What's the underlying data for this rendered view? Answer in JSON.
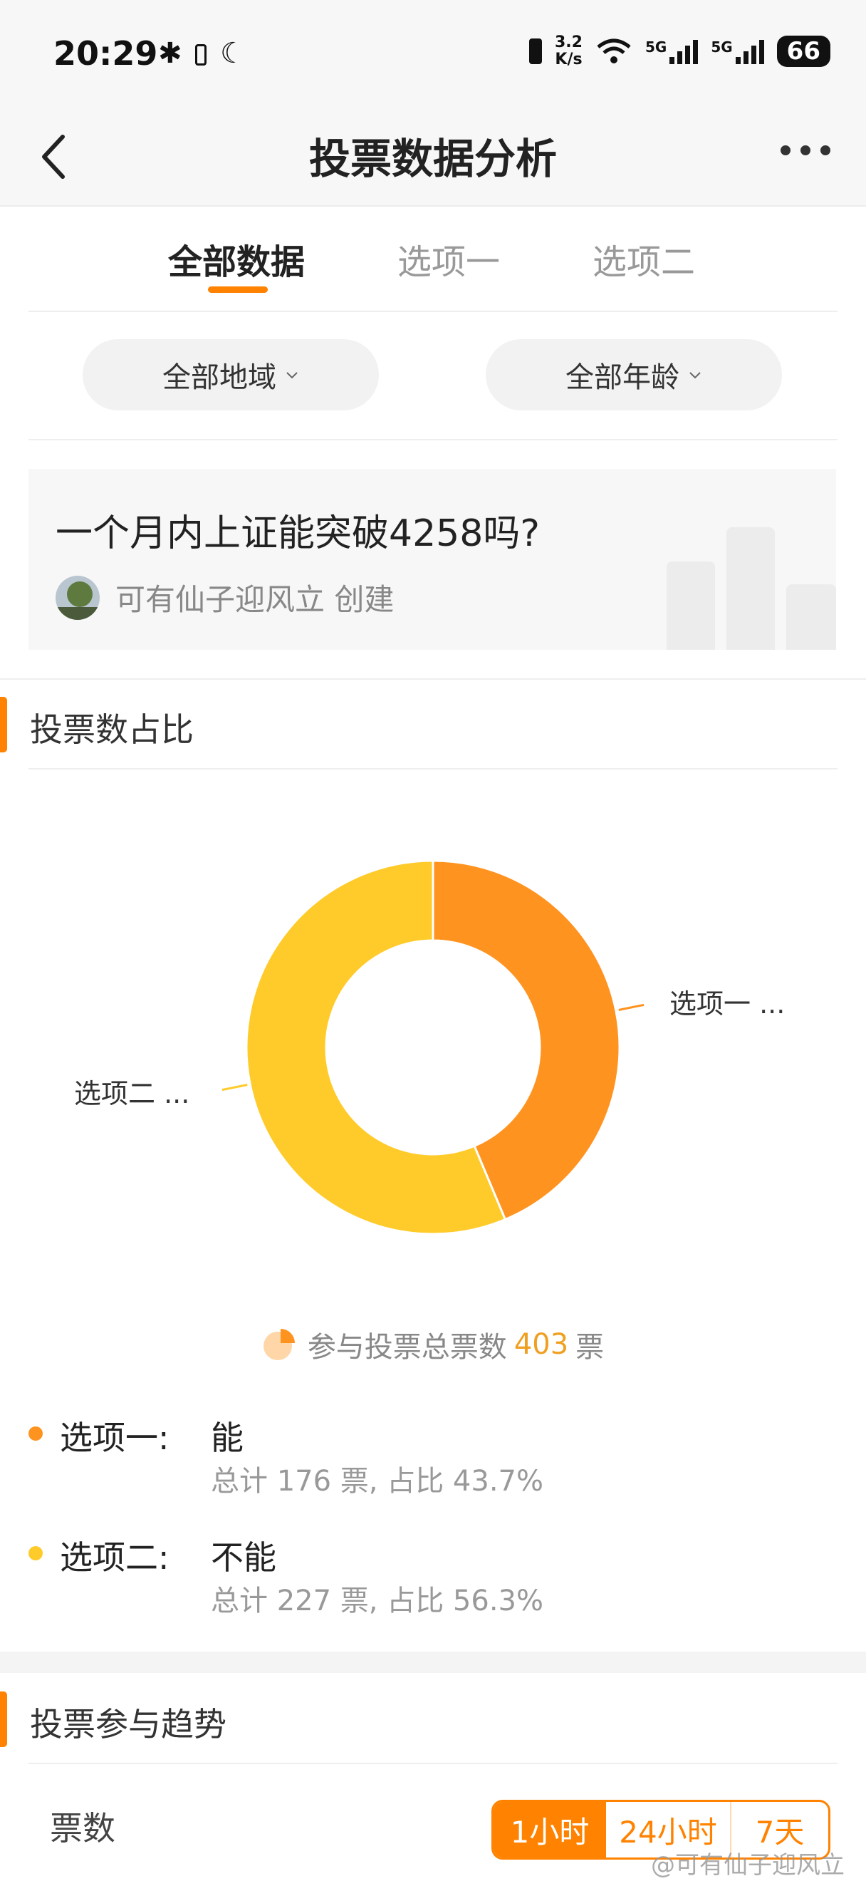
{
  "status_bar": {
    "time": "20:29",
    "network_speed_top": "3.2",
    "network_speed_bottom": "K/s",
    "sim1": "5G",
    "sim2": "5G",
    "battery": "66"
  },
  "header": {
    "title": "投票数据分析"
  },
  "tabs": [
    {
      "label": "全部数据",
      "active": true
    },
    {
      "label": "选项一",
      "active": false
    },
    {
      "label": "选项二",
      "active": false
    }
  ],
  "filters": {
    "region": "全部地域",
    "age": "全部年龄"
  },
  "poll": {
    "question": "一个月内上证能突破4258吗?",
    "creator": "可有仙子迎风立 创建"
  },
  "vote_share": {
    "section_title": "投票数占比",
    "slice_labels": [
      "选项一 ...",
      "选项二 ..."
    ],
    "total_prefix": "参与投票总票数",
    "total": "403",
    "total_suffix": "票"
  },
  "chart_data": {
    "type": "pie",
    "categories": [
      "选项一",
      "选项二"
    ],
    "values": [
      176,
      227
    ],
    "colors": [
      "#ff9320",
      "#ffcb2a"
    ]
  },
  "options": [
    {
      "label": "选项一:",
      "answer": "能",
      "stat": "总计 176 票, 占比 43.7%",
      "color": "#ff9320"
    },
    {
      "label": "选项二:",
      "answer": "不能",
      "stat": "总计 227 票, 占比 56.3%",
      "color": "#ffcb2a"
    }
  ],
  "trend": {
    "section_title": "投票参与趋势",
    "y_label": "票数",
    "ranges": [
      "1小时",
      "24小时",
      "7天"
    ],
    "active_range": "1小时"
  },
  "watermark": "@可有仙子迎风立",
  "icons": [
    "bluetooth-icon",
    "battery-icon",
    "moon-icon",
    "vibrate-icon",
    "wifi-icon",
    "signal-icon",
    "back-icon",
    "more-icon",
    "chevron-down-icon",
    "pie-icon"
  ]
}
